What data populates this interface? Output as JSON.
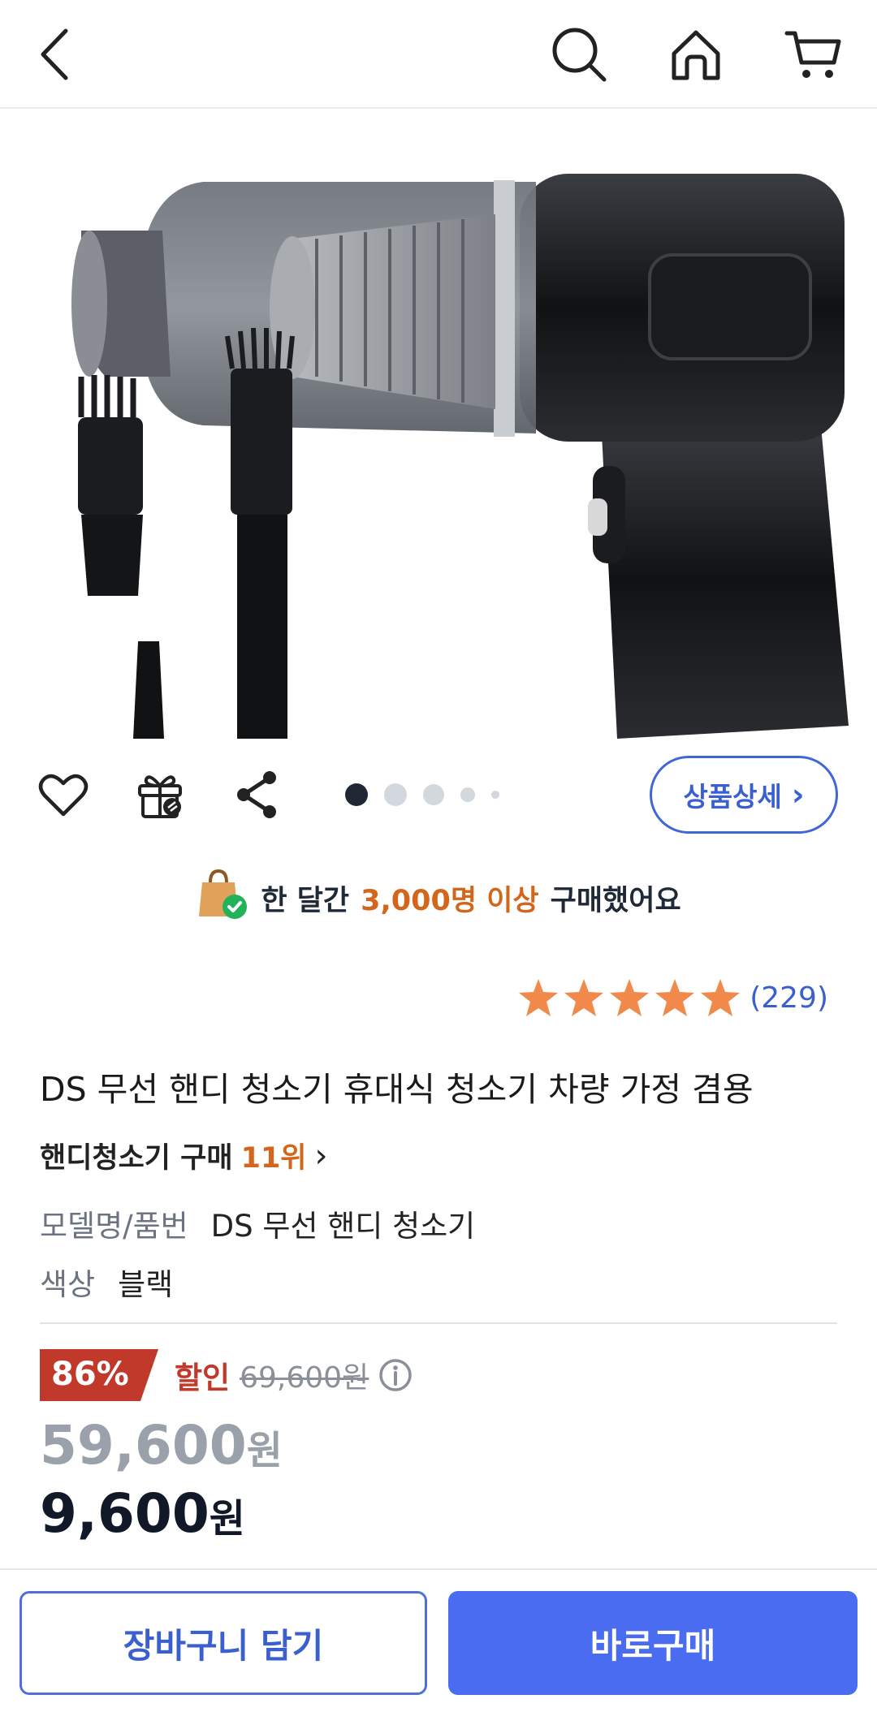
{
  "header": {
    "back_icon": "chevron-left-icon",
    "search_icon": "search-icon",
    "home_icon": "home-icon",
    "cart_icon": "cart-icon"
  },
  "product_image": {
    "alt": "무선 핸디 청소기 본체와 노즐"
  },
  "actions": {
    "like_icon": "heart-icon",
    "gift_icon": "gift-icon",
    "share_icon": "share-icon",
    "gallery_dots_total": 5,
    "gallery_dots_active": 1,
    "detail_button": "상품상세",
    "detail_chevron": "›"
  },
  "buyers": {
    "prefix": "한 달간",
    "highlight": "3,000명 이상",
    "suffix": "구매했어요"
  },
  "rating": {
    "stars": 5,
    "count": "(229)",
    "color": "#f0894a"
  },
  "product": {
    "title": "DS 무선 핸디 청소기 휴대식 청소기 차량 가정 겸용",
    "rank_prefix": "핸디청소기 구매",
    "rank_value": "11위",
    "rank_chevron": "›",
    "specs": [
      {
        "key": "모델명/품번",
        "value": "DS 무선 핸디 청소기"
      },
      {
        "key": "색상",
        "value": "블랙"
      }
    ]
  },
  "pricing": {
    "discount_percent": "86%",
    "discount_label": "할인",
    "original_price": "69,600원",
    "sale_price_number": "59,600",
    "sale_price_unit": "원",
    "final_price_number": "9,600",
    "final_price_unit": "원",
    "info_icon": "info-icon"
  },
  "bottom_bar": {
    "cart_button": "장바구니 담기",
    "buy_button": "바로구매"
  },
  "colors": {
    "accent_blue": "#4a6cf0",
    "highlight_orange": "#d4661b",
    "discount_red": "#c0392b"
  }
}
